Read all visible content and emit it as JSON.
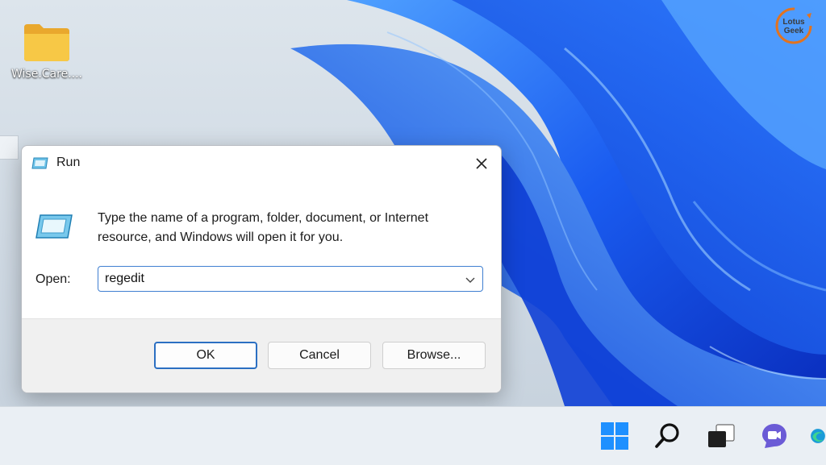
{
  "desktop": {
    "icons": [
      {
        "label": "Wise.Care...."
      }
    ],
    "watermark": {
      "line1": "Lotus",
      "line2": "Geek"
    }
  },
  "dialog": {
    "title": "Run",
    "description": "Type the name of a program, folder, document, or Internet resource, and Windows will open it for you.",
    "open_label": "Open:",
    "open_value": "regedit",
    "buttons": {
      "ok": "OK",
      "cancel": "Cancel",
      "browse": "Browse..."
    }
  },
  "taskbar": {
    "items": [
      "start-icon",
      "search-icon",
      "task-view-icon",
      "chat-icon",
      "edge-icon"
    ]
  },
  "colors": {
    "accent": "#2b6fc2",
    "wallpaper_blue": "#1a5cf0",
    "taskbar": "#eaeff4"
  }
}
